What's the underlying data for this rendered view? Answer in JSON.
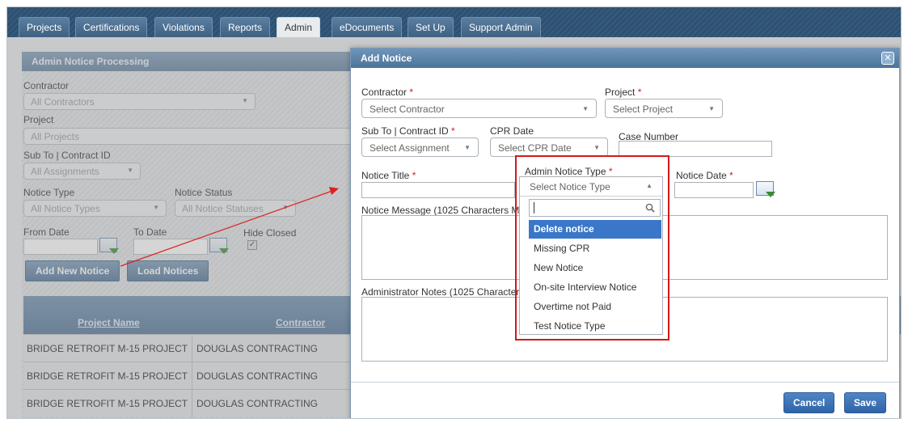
{
  "tabs": [
    {
      "label": "Projects"
    },
    {
      "label": "Certifications"
    },
    {
      "label": "Violations"
    },
    {
      "label": "Reports"
    },
    {
      "label": "Admin"
    },
    {
      "label": "eDocuments"
    },
    {
      "label": "Set Up"
    },
    {
      "label": "Support Admin"
    }
  ],
  "background": {
    "panel_title": "Admin Notice Processing",
    "contractor_label": "Contractor",
    "contractor_value": "All Contractors",
    "project_label": "Project",
    "project_value": "All Projects",
    "sub_label": "Sub To | Contract ID",
    "sub_value": "All Assignments",
    "notice_type_label": "Notice Type",
    "notice_type_value": "All Notice Types",
    "notice_status_label": "Notice Status",
    "notice_status_value": "All Notice Statuses",
    "from_date_label": "From Date",
    "to_date_label": "To Date",
    "hide_closed_label": "Hide Closed",
    "add_new_label": "Add New Notice",
    "load_label": "Load Notices",
    "grid_columns": [
      "Project Name",
      "Contractor"
    ],
    "rows": [
      {
        "project": "BRIDGE RETROFIT M-15 PROJECT",
        "contractor": "DOUGLAS CONTRACTING"
      },
      {
        "project": "BRIDGE RETROFIT M-15 PROJECT",
        "contractor": "DOUGLAS CONTRACTING"
      },
      {
        "project": "BRIDGE RETROFIT M-15 PROJECT",
        "contractor": "DOUGLAS CONTRACTING"
      }
    ]
  },
  "modal": {
    "title": "Add Notice",
    "close_glyph": "✕",
    "required_mark": "*",
    "contractor_label": "Contractor",
    "contractor_placeholder": "Select Contractor",
    "project_label": "Project",
    "project_placeholder": "Select Project",
    "sub_label": "Sub To | Contract ID",
    "sub_placeholder": "Select Assignment",
    "cpr_label": "CPR Date",
    "cpr_placeholder": "Select CPR Date",
    "case_label": "Case Number",
    "notice_title_label": "Notice Title",
    "admin_type_label": "Admin Notice Type",
    "notice_date_label": "Notice Date",
    "message_label_visible": "Notice Message (1025 Characters Ma",
    "notes_label_visible": "Administrator Notes (1025 Characters",
    "cancel_label": "Cancel",
    "save_label": "Save"
  },
  "dropdown": {
    "placeholder": "Select Notice Type",
    "search_value": "",
    "options": [
      {
        "label": "Delete notice",
        "highlighted": true
      },
      {
        "label": "Missing CPR"
      },
      {
        "label": "New Notice"
      },
      {
        "label": "On-site Interview Notice"
      },
      {
        "label": "Overtime not Paid"
      },
      {
        "label": "Test Notice Type"
      }
    ]
  },
  "colors": {
    "accent": "#3a77c9",
    "highlight_box": "#d11a1a",
    "header": "#4c7398"
  }
}
